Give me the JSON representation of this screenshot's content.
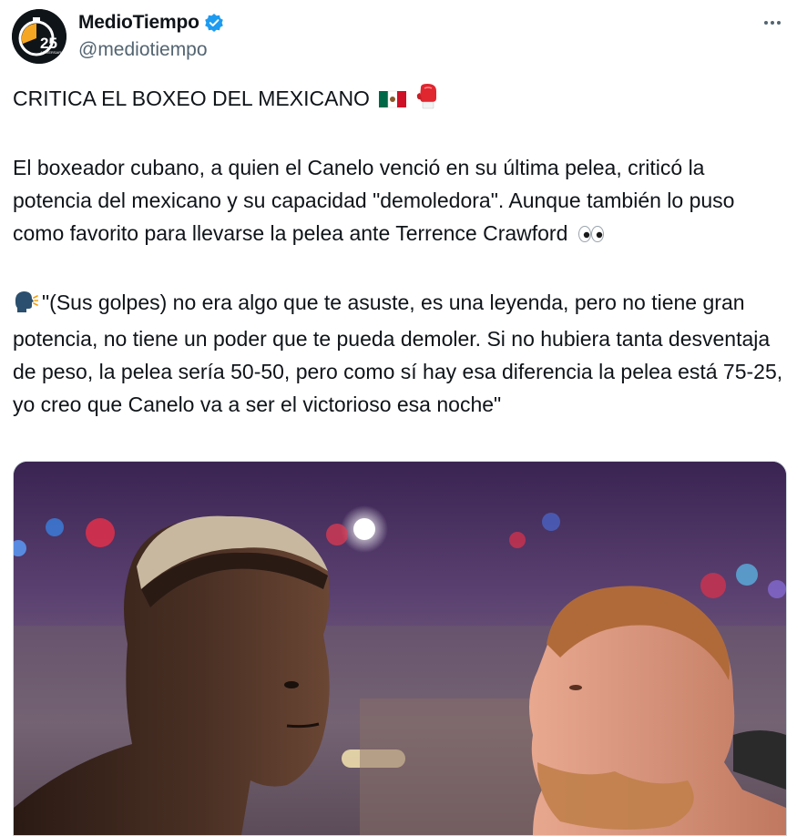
{
  "author": {
    "display_name": "MedioTiempo",
    "handle": "@mediotiempo",
    "avatar_badge": "25",
    "avatar_subtext": "ANIVERSARIO",
    "verified": true
  },
  "more_icon": "more-dots-icon",
  "tweet": {
    "headline": "CRITICA EL BOXEO DEL MEXICANO",
    "headline_emojis": [
      "mexico-flag-emoji",
      "boxing-glove-emoji"
    ],
    "paragraph1": "El boxeador cubano, a quien el Canelo venció en su última pelea, criticó la potencia del mexicano y su capacidad \"demoledora\". Aunque también lo puso como favorito para llevarse la pelea ante Terrence Crawford",
    "paragraph1_emoji": "eyes-emoji",
    "quote_emoji": "speaking-head-emoji",
    "quote": "\"(Sus golpes) no era algo que te asuste, es una leyenda, pero no tiene gran potencia, no tiene un poder que te pueda demoler. Si no hubiera tanta desventaja de peso, la pelea sería 50-50, pero como sí hay esa diferencia la pelea está 75-25, yo creo que Canelo va a ser el victorioso esa noche\""
  },
  "media": {
    "type": "photo"
  },
  "colors": {
    "text": "#0f1419",
    "secondary": "#536471",
    "verified": "#1d9bf0",
    "avatar_accent": "#f5a623"
  }
}
